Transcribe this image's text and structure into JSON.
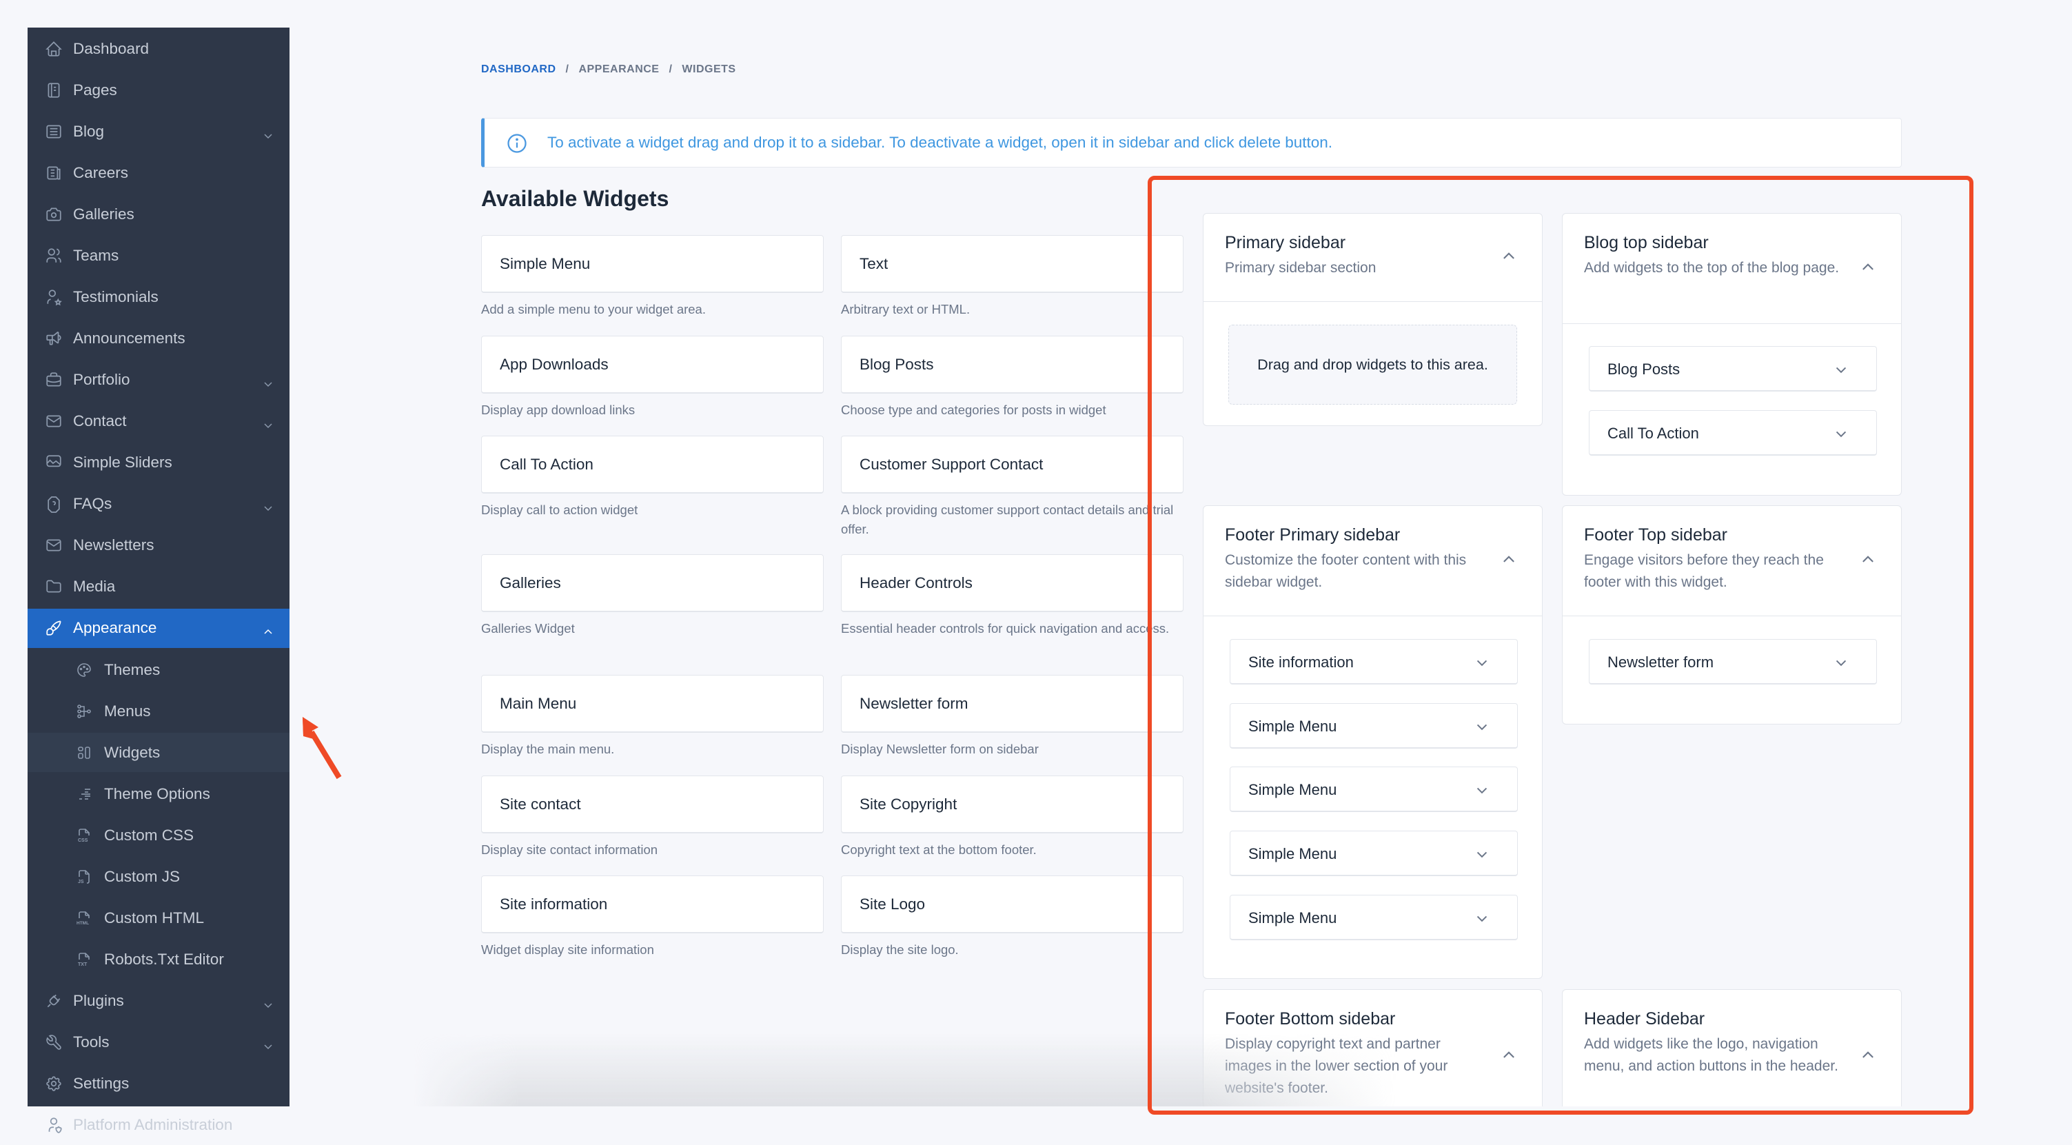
{
  "sidebar": {
    "items": [
      {
        "label": "Dashboard",
        "icon": "home-icon",
        "expandable": false
      },
      {
        "label": "Pages",
        "icon": "pages-icon",
        "expandable": false
      },
      {
        "label": "Blog",
        "icon": "blog-icon",
        "expandable": true
      },
      {
        "label": "Careers",
        "icon": "careers-icon",
        "expandable": false
      },
      {
        "label": "Galleries",
        "icon": "camera-icon",
        "expandable": false
      },
      {
        "label": "Teams",
        "icon": "users-icon",
        "expandable": false
      },
      {
        "label": "Testimonials",
        "icon": "user-star-icon",
        "expandable": false
      },
      {
        "label": "Announcements",
        "icon": "speakerphone-icon",
        "expandable": false
      },
      {
        "label": "Portfolio",
        "icon": "briefcase-icon",
        "expandable": true
      },
      {
        "label": "Contact",
        "icon": "mail-icon",
        "expandable": true
      },
      {
        "label": "Simple Sliders",
        "icon": "slideshow-icon",
        "expandable": false
      },
      {
        "label": "FAQs",
        "icon": "help-octagon-icon",
        "expandable": true
      },
      {
        "label": "Newsletters",
        "icon": "mail-icon",
        "expandable": false
      },
      {
        "label": "Media",
        "icon": "folder-icon",
        "expandable": false
      },
      {
        "label": "Appearance",
        "icon": "brush-icon",
        "expandable": true,
        "active": true,
        "expanded": true
      },
      {
        "label": "Plugins",
        "icon": "plug-icon",
        "expandable": true
      },
      {
        "label": "Tools",
        "icon": "tool-icon",
        "expandable": true
      },
      {
        "label": "Settings",
        "icon": "settings-icon",
        "expandable": false
      },
      {
        "label": "Platform Administration",
        "icon": "user-shield-icon",
        "expandable": false
      }
    ],
    "appearance_sub": [
      {
        "label": "Themes",
        "icon": "palette-icon"
      },
      {
        "label": "Menus",
        "icon": "sitemap-icon"
      },
      {
        "label": "Widgets",
        "icon": "layout-icon",
        "current": true
      },
      {
        "label": "Theme Options",
        "icon": "list-details-icon"
      },
      {
        "label": "Custom CSS",
        "icon": "file-css-icon"
      },
      {
        "label": "Custom JS",
        "icon": "file-js-icon"
      },
      {
        "label": "Custom HTML",
        "icon": "file-html-icon"
      },
      {
        "label": "Robots.Txt Editor",
        "icon": "file-txt-icon"
      }
    ]
  },
  "breadcrumb": [
    "DASHBOARD",
    "APPEARANCE",
    "WIDGETS"
  ],
  "breadcrumb_sep": "/",
  "alert": {
    "text": "To activate a widget drag and drop it to a sidebar. To deactivate a widget, open it in sidebar and click delete button."
  },
  "available": {
    "title": "Available Widgets",
    "widgets": [
      {
        "name": "Simple Menu",
        "desc": "Add a simple menu to your widget area."
      },
      {
        "name": "Text",
        "desc": "Arbitrary text or HTML."
      },
      {
        "name": "App Downloads",
        "desc": "Display app download links"
      },
      {
        "name": "Blog Posts",
        "desc": "Choose type and categories for posts in widget"
      },
      {
        "name": "Call To Action",
        "desc": "Display call to action widget"
      },
      {
        "name": "Customer Support Contact",
        "desc": "A block providing customer support contact details and trial offer."
      },
      {
        "name": "Galleries",
        "desc": "Galleries Widget"
      },
      {
        "name": "Header Controls",
        "desc": "Essential header controls for quick navigation and access."
      },
      {
        "name": "Main Menu",
        "desc": "Display the main menu."
      },
      {
        "name": "Newsletter form",
        "desc": "Display Newsletter form on sidebar"
      },
      {
        "name": "Site contact",
        "desc": "Display site contact information"
      },
      {
        "name": "Site Copyright",
        "desc": "Copyright text at the bottom footer."
      },
      {
        "name": "Site information",
        "desc": "Widget display site information"
      },
      {
        "name": "Site Logo",
        "desc": "Display the site logo."
      }
    ]
  },
  "sidebars": [
    {
      "title": "Primary sidebar",
      "desc": "Primary sidebar section",
      "empty_text": "Drag and drop widgets to this area.",
      "widgets": []
    },
    {
      "title": "Blog top sidebar",
      "desc": "Add widgets to the top of the blog page.",
      "widgets": [
        "Blog Posts",
        "Call To Action"
      ]
    },
    {
      "title": "Footer Primary sidebar",
      "desc": "Customize the footer content with this sidebar widget.",
      "widgets": [
        "Site information",
        "Simple Menu",
        "Simple Menu",
        "Simple Menu",
        "Simple Menu"
      ]
    },
    {
      "title": "Footer Top sidebar",
      "desc": "Engage visitors before they reach the footer with this widget.",
      "widgets": [
        "Newsletter form"
      ]
    },
    {
      "title": "Footer Bottom sidebar",
      "desc": "Display copyright text and partner images in the lower section of your website's footer.",
      "widgets": []
    },
    {
      "title": "Header Sidebar",
      "desc": "Add widgets like the logo, navigation menu, and action buttons in the header.",
      "widgets": []
    }
  ],
  "colors": {
    "accent": "#2168c5",
    "sidebar_bg": "#2e3748",
    "annotation": "#ef4a26",
    "info": "#4a98e0"
  }
}
